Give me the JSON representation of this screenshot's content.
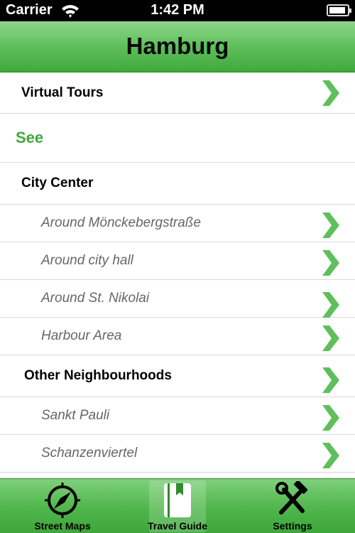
{
  "status": {
    "carrier": "Carrier",
    "time": "1:42 PM"
  },
  "nav": {
    "title": "Hamburg"
  },
  "list": {
    "virtual_tours": "Virtual Tours",
    "see_header": "See",
    "city_center": "City Center",
    "items_center": [
      "Around Mönckebergstraße",
      "Around city hall",
      "Around St. Nikolai",
      "Harbour Area"
    ],
    "other_neighbourhoods": "Other Neighbourhoods",
    "items_other": [
      "Sankt Pauli",
      "Schanzenviertel"
    ]
  },
  "tabs": [
    {
      "label": "Street Maps",
      "icon": "compass-icon"
    },
    {
      "label": "Travel Guide",
      "icon": "book-icon"
    },
    {
      "label": "Settings",
      "icon": "tools-icon"
    }
  ],
  "colors": {
    "accent": "#3fa93c",
    "chevron": "#5fbf5b"
  }
}
